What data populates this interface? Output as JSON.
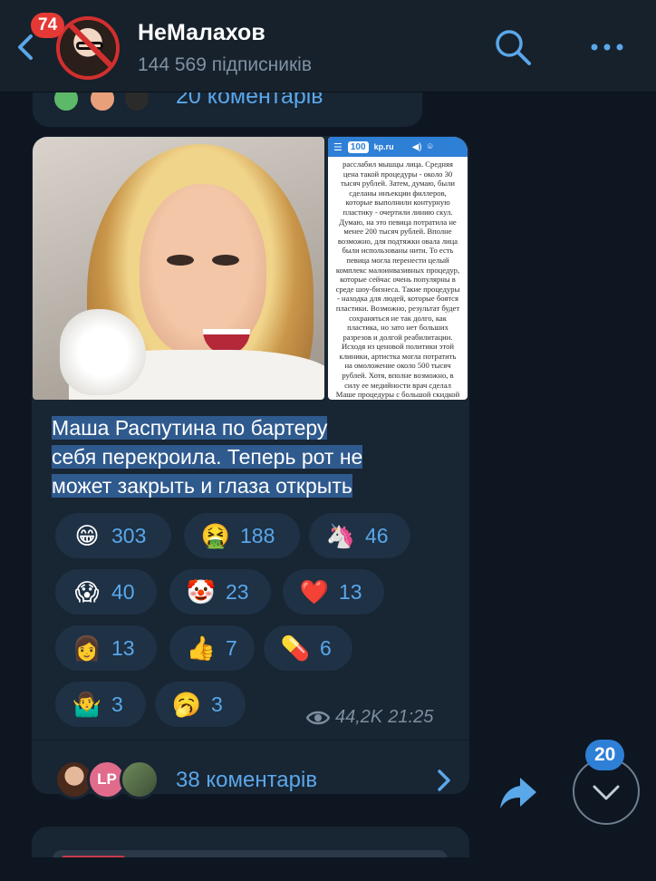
{
  "header": {
    "unread_count": "74",
    "channel_name": "НеМалахов",
    "subscribers": "144 569 підписників",
    "icons": [
      "back-arrow-icon",
      "search-icon",
      "more-icon"
    ]
  },
  "previous_post": {
    "comments_label": "20 коментарів"
  },
  "post": {
    "images": [
      {
        "kind": "photo",
        "subject": "woman-smiling-with-tissue"
      },
      {
        "kind": "article-screenshot",
        "site": "kp.ru",
        "logo": "100",
        "text": "расслабил мышцы лица. Средняя цена такой процедуры - около 30 тысяч рублей. Затем, думаю, были сделаны инъекции филлеров, которые выполнили контурную пластику - очертили линию скул. Думаю, на это певица потратила не менее 200 тысяч рублей. Вполне возможно, для подтяжки овала лица были использованы нити. То есть певица могла перенести целый комплекс малоинвазивных процедур, которые сейчас очень популярны в среде шоу-бизнеса. Такие процедуры - находка для людей, которые боятся пластики. Возможно, результат будет сохраняться не так долго, как пластика, но зато нет больших разрезов и долгой реабилитации. Исходя из ценовой политики этой клиники, артистка могла потратить на омоложение около 500 тысяч рублей. Хотя, вполне возможно, в силу ее медийности врач сделал Маше процедуры с большой скидкой или вовсе бесплатно, по бартеру."
      }
    ],
    "caption_lines": [
      "Маша Распутина по бартеру",
      "себя перекроила. Теперь рот не",
      "может закрыть и глаза открыть"
    ],
    "reactions": [
      {
        "emoji": "😁",
        "count": "303"
      },
      {
        "emoji": "🤮",
        "count": "188"
      },
      {
        "emoji": "🦄",
        "count": "46"
      },
      {
        "emoji": "😱",
        "count": "40"
      },
      {
        "emoji": "🤡",
        "count": "23"
      },
      {
        "emoji": "❤️",
        "count": "13"
      },
      {
        "emoji": "👩",
        "count": "13"
      },
      {
        "emoji": "👍",
        "count": "7"
      },
      {
        "emoji": "💊",
        "count": "6"
      },
      {
        "emoji": "🤷‍♂️",
        "count": "3"
      },
      {
        "emoji": "🥱",
        "count": "3"
      }
    ],
    "views": "44,2K",
    "time": "21:25",
    "comments": {
      "label": "38 коментарів",
      "avatar_initials": "LP"
    }
  },
  "scroll_down": {
    "count": "20"
  },
  "colors": {
    "background": "#0e1621",
    "bubble": "#182533",
    "accent": "#5aa7ea",
    "reaction_bg": "#1e3145",
    "selection": "#2f5a8e",
    "badge_red": "#e53935",
    "badge_blue": "#2e7fd6"
  }
}
